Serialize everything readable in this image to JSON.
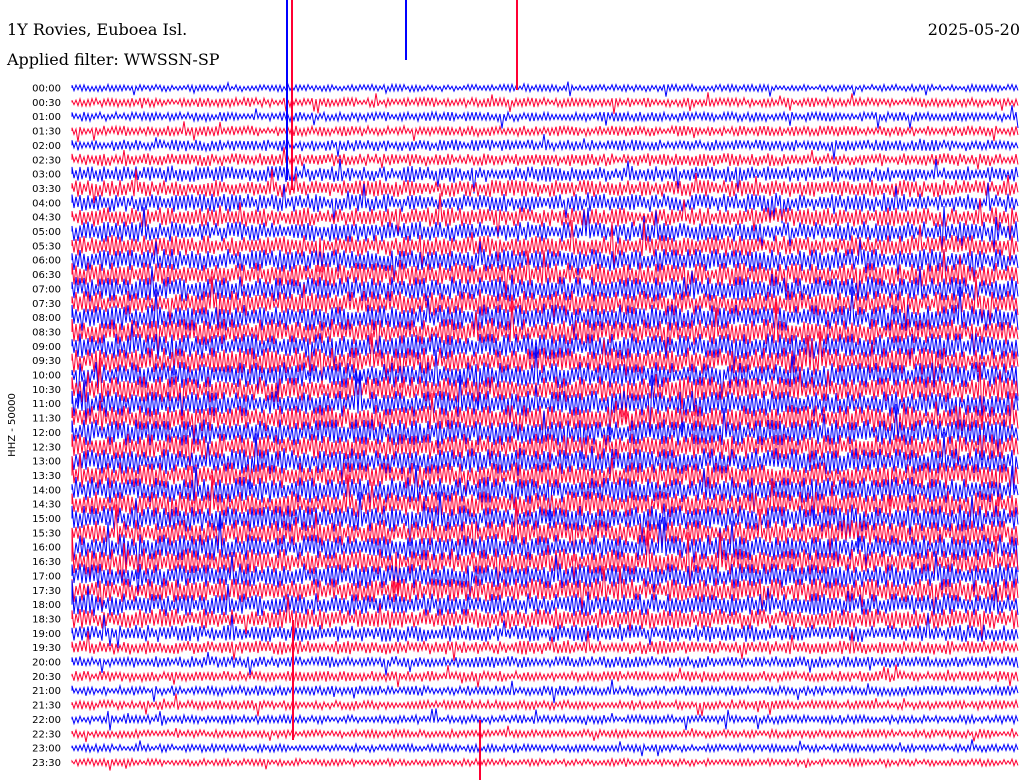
{
  "header": {
    "station": "1Y Rovies, Euboea Isl.",
    "date": "2025-05-20",
    "filter": "Applied filter: WWSSN-SP"
  },
  "chart_data": {
    "type": "line",
    "ylabel": "HHZ - 50000",
    "rows": [
      "00:00",
      "00:30",
      "01:00",
      "01:30",
      "02:00",
      "02:30",
      "03:00",
      "03:30",
      "04:00",
      "04:30",
      "05:00",
      "05:30",
      "06:00",
      "06:30",
      "07:00",
      "07:30",
      "08:00",
      "08:30",
      "09:00",
      "09:30",
      "10:00",
      "10:30",
      "11:00",
      "11:30",
      "12:00",
      "12:30",
      "13:00",
      "13:30",
      "14:00",
      "14:30",
      "15:00",
      "15:30",
      "16:00",
      "16:30",
      "17:00",
      "17:30",
      "18:00",
      "18:30",
      "19:00",
      "19:30",
      "20:00",
      "20:30",
      "21:00",
      "21:30",
      "22:00",
      "22:30",
      "23:00",
      "23:30"
    ],
    "row_minutes": 30,
    "trace_colors": [
      "#0000ff",
      "#ff0033"
    ],
    "noise_level_by_row": [
      0.15,
      0.25,
      0.25,
      0.3,
      0.35,
      0.4,
      0.55,
      0.6,
      0.65,
      0.7,
      0.75,
      0.8,
      0.85,
      0.9,
      0.95,
      0.95,
      1.0,
      1.0,
      1.0,
      1.0,
      1.0,
      1.0,
      1.0,
      1.0,
      1.0,
      1.0,
      1.0,
      1.0,
      1.0,
      1.0,
      1.0,
      1.0,
      1.0,
      1.0,
      0.95,
      0.9,
      0.85,
      0.75,
      0.6,
      0.45,
      0.35,
      0.3,
      0.28,
      0.25,
      0.22,
      0.2,
      0.18,
      0.16
    ]
  }
}
